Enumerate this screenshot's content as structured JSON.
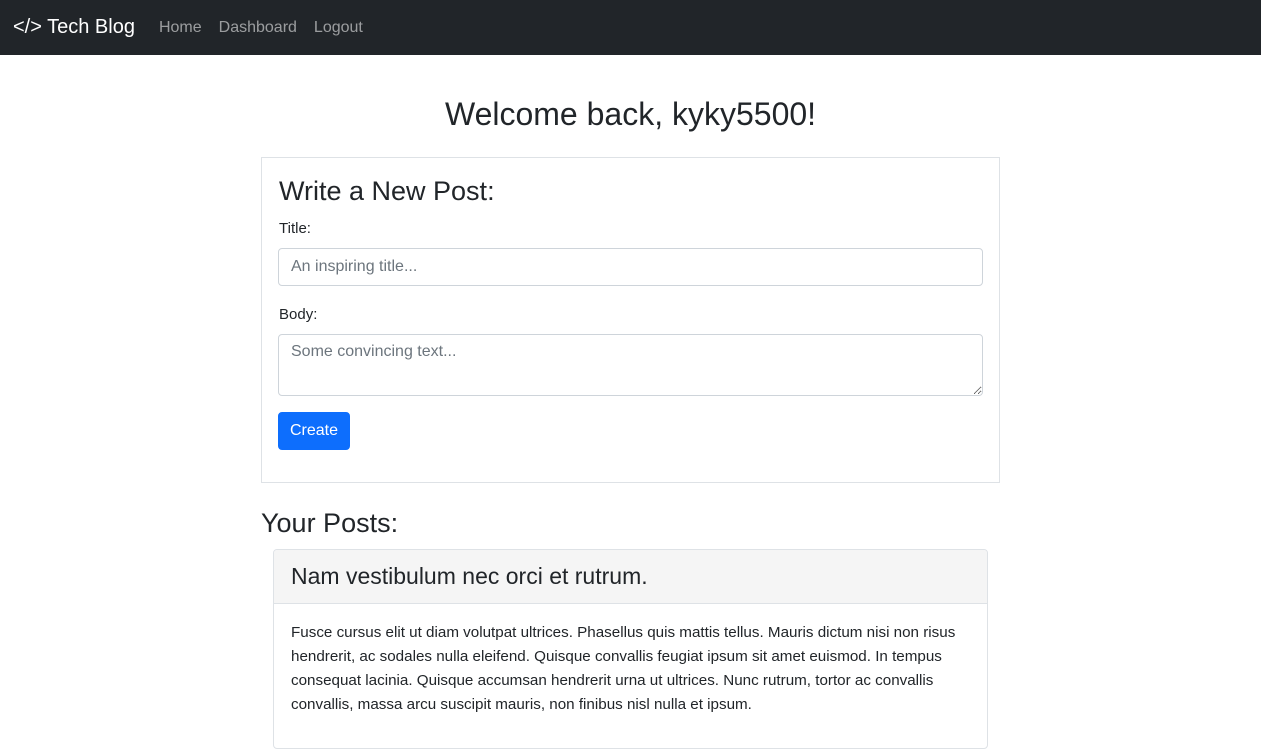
{
  "navbar": {
    "brand": "</> Tech Blog",
    "links": [
      "Home",
      "Dashboard",
      "Logout"
    ]
  },
  "welcome": "Welcome back, kyky5500!",
  "new_post_form": {
    "heading": "Write a New Post:",
    "title_label": "Title:",
    "title_placeholder": "An inspiring title...",
    "body_label": "Body:",
    "body_placeholder": "Some convincing text...",
    "create_label": "Create"
  },
  "posts_section": {
    "heading": "Your Posts:",
    "posts": [
      {
        "title": "Nam vestibulum nec orci et rutrum.",
        "body": "Fusce cursus elit ut diam volutpat ultrices. Phasellus quis mattis tellus. Mauris dictum nisi non risus hendrerit, ac sodales nulla eleifend. Quisque convallis feugiat ipsum sit amet euismod. In tempus consequat lacinia. Quisque accumsan hendrerit urna ut ultrices. Nunc rutrum, tortor ac convallis convallis, massa arcu suscipit mauris, non finibus nisl nulla et ipsum."
      }
    ]
  },
  "colors": {
    "navbar_bg": "#212529",
    "primary_button": "#0d6efd",
    "card_header_bg": "#f5f5f5"
  }
}
